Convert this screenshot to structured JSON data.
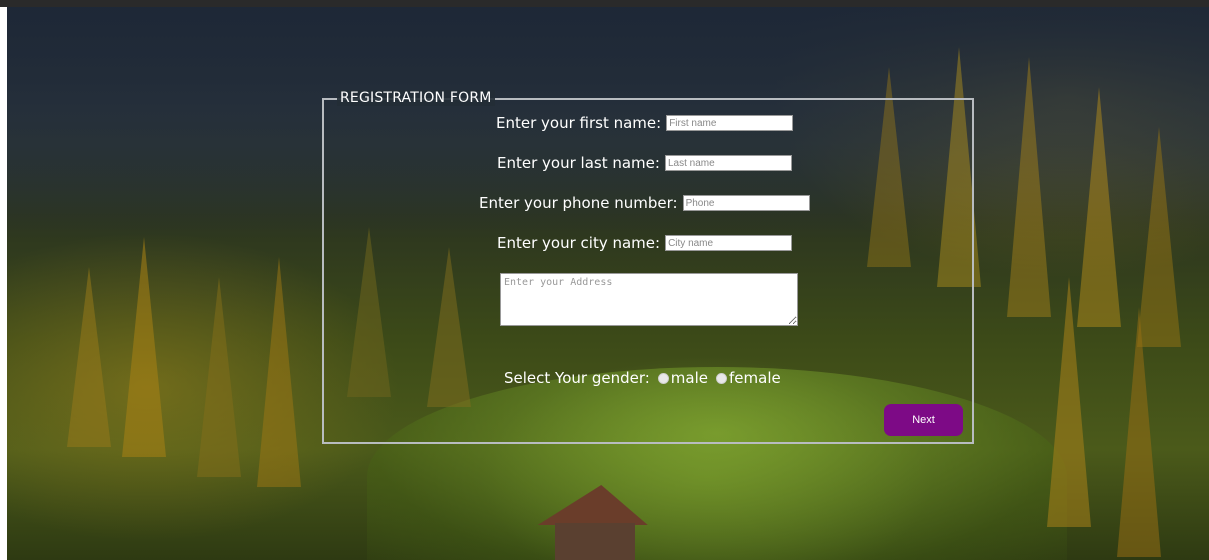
{
  "form": {
    "legend": "REGISTRATION FORM",
    "first_name": {
      "label": "Enter your first name:",
      "placeholder": "First name"
    },
    "last_name": {
      "label": "Enter your last name:",
      "placeholder": "Last name"
    },
    "phone": {
      "label": "Enter your phone number:",
      "placeholder": "Phone"
    },
    "city": {
      "label": "Enter your city name:",
      "placeholder": "City name"
    },
    "address": {
      "placeholder": "Enter your Address"
    },
    "gender": {
      "label": "Select Your gender:",
      "options": [
        "male",
        "female"
      ]
    },
    "next_label": "Next"
  },
  "colors": {
    "button": "#7d0a86",
    "border": "#b8bcc0",
    "text": "#ffffff"
  }
}
